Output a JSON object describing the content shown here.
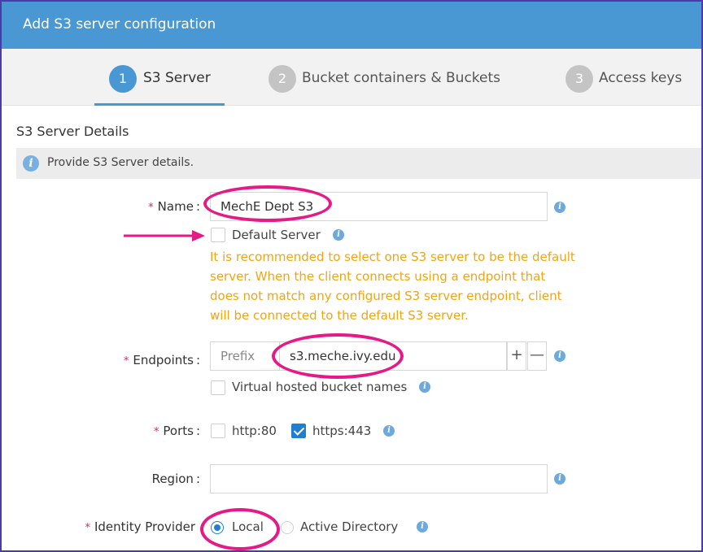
{
  "window": {
    "title": "Add S3 server configuration"
  },
  "steps": [
    {
      "num": "1",
      "label": "S3 Server",
      "active": true
    },
    {
      "num": "2",
      "label": "Bucket containers & Buckets",
      "active": false
    },
    {
      "num": "3",
      "label": "Access keys",
      "active": false
    }
  ],
  "section": {
    "title": "S3 Server Details",
    "info": "Provide S3 Server details."
  },
  "form": {
    "name": {
      "label": "Name",
      "value": "MechE Dept S3",
      "required": true
    },
    "default_server": {
      "label": "Default Server",
      "checked": false
    },
    "warning": "It is recommended to select one S3 server to be the default server. When the client connects using a endpoint that does not match any configured S3 server endpoint, client will be connected to the default S3 server.",
    "endpoints": {
      "label": "Endpoints",
      "prefix": "Prefix",
      "value": "s3.meche.ivy.edu",
      "add": "+",
      "remove": "—",
      "required": true
    },
    "virtual_hosted": {
      "label": "Virtual hosted bucket names",
      "checked": false
    },
    "ports": {
      "label": "Ports",
      "required": true,
      "http": {
        "label": "http:80",
        "checked": false
      },
      "https": {
        "label": "https:443",
        "checked": true
      }
    },
    "region": {
      "label": "Region",
      "value": ""
    },
    "identity_provider": {
      "label": "Identity Provider",
      "required": true,
      "options": [
        "Local",
        "Active Directory"
      ],
      "selected": "Local"
    }
  },
  "colors": {
    "accent": "#4a98d3",
    "warning": "#f2a414",
    "required": "#e0245e",
    "highlight": "#e51a86"
  },
  "icons": {
    "info": "i",
    "required": "*"
  }
}
